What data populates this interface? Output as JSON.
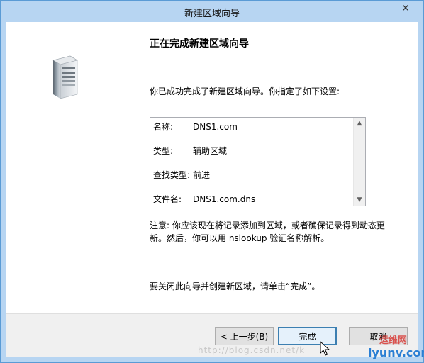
{
  "window": {
    "title": "新建区域向导",
    "close_label": "✕"
  },
  "page": {
    "heading": "正在完成新建区域向导",
    "intro": "你已成功完成了新建区域向导。你指定了如下设置:",
    "summary": [
      {
        "key": "名称:",
        "value": "DNS1.com"
      },
      {
        "key": "类型:",
        "value": "辅助区域"
      },
      {
        "key": "查找类型:",
        "value": "前进"
      },
      {
        "key": "文件名:",
        "value": "DNS1.com.dns"
      }
    ],
    "note_line1": "注意: 你应该现在将记录添加到区域，或者确保记录得到动态更",
    "note_line2": "新。然后，你可以用 nslookup 验证名称解析。",
    "close_hint": "要关闭此向导并创建新区域，请单击“完成”。"
  },
  "buttons": {
    "back": "< 上一步(B)",
    "finish": "完成",
    "cancel": "取消"
  },
  "watermark": {
    "url": "http://blog.csdn.net/k",
    "logo_top": "运维网",
    "logo_bottom": "iyunv.com"
  },
  "icons": {
    "server": "server-tower-icon",
    "close": "close-icon",
    "scroll_up": "scroll-up-arrow-icon",
    "scroll_down": "scroll-down-arrow-icon",
    "cursor": "mouse-pointer-icon"
  }
}
